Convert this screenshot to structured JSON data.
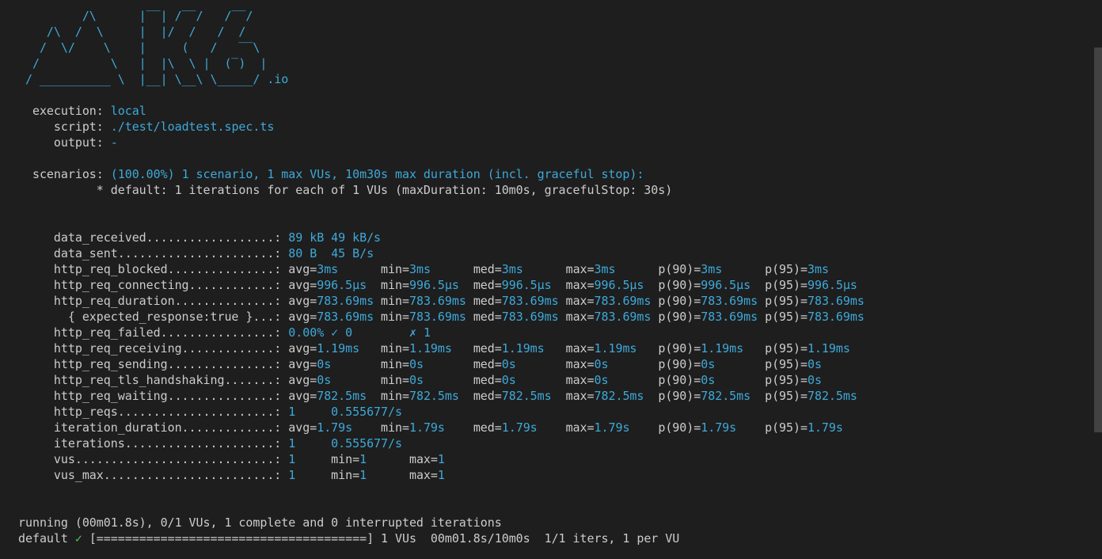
{
  "logo": {
    "lines": [
      "         /\\      |‾‾| /‾‾/   /‾‾/",
      "    /\\  /  \\     |  |/  /   /  /",
      "   /  \\/    \\    |     (   /   ‾‾\\",
      "  /          \\   |  |\\  \\ |  (‾)  |",
      " / __________ \\  |__| \\__\\ \\_____/"
    ],
    "suffix": " .io"
  },
  "execution": {
    "execution_label": "  execution: ",
    "execution_value": "local",
    "script_label": "     script: ",
    "script_value": "./test/loadtest.spec.ts",
    "output_label": "     output: ",
    "output_value": "-"
  },
  "scenarios": {
    "label": "  scenarios: ",
    "summary": "(100.00%) 1 scenario, 1 max VUs, 10m30s max duration (incl. graceful stop):",
    "detail": "           * default: 1 iterations for each of 1 VUs (maxDuration: 10m0s, gracefulStop: 30s)"
  },
  "metrics": [
    {
      "name": "     data_received..................: ",
      "cols": [
        [
          "",
          "89 kB"
        ],
        [
          " ",
          "49 kB/s"
        ]
      ]
    },
    {
      "name": "     data_sent......................: ",
      "cols": [
        [
          "",
          "80 B"
        ],
        [
          "  ",
          "45 B/s"
        ]
      ]
    },
    {
      "name": "     http_req_blocked...............: ",
      "cols": [
        [
          "avg=",
          "3ms"
        ],
        [
          "      min=",
          "3ms"
        ],
        [
          "      med=",
          "3ms"
        ],
        [
          "      max=",
          "3ms"
        ],
        [
          "      p(90)=",
          "3ms"
        ],
        [
          "      p(95)=",
          "3ms"
        ]
      ]
    },
    {
      "name": "     http_req_connecting............: ",
      "cols": [
        [
          "avg=",
          "996.5µs"
        ],
        [
          "  min=",
          "996.5µs"
        ],
        [
          "  med=",
          "996.5µs"
        ],
        [
          "  max=",
          "996.5µs"
        ],
        [
          "  p(90)=",
          "996.5µs"
        ],
        [
          "  p(95)=",
          "996.5µs"
        ]
      ]
    },
    {
      "name": "     http_req_duration..............: ",
      "cols": [
        [
          "avg=",
          "783.69ms"
        ],
        [
          " min=",
          "783.69ms"
        ],
        [
          " med=",
          "783.69ms"
        ],
        [
          " max=",
          "783.69ms"
        ],
        [
          " p(90)=",
          "783.69ms"
        ],
        [
          " p(95)=",
          "783.69ms"
        ]
      ]
    },
    {
      "name": "       { expected_response:true }...: ",
      "cols": [
        [
          "avg=",
          "783.69ms"
        ],
        [
          " min=",
          "783.69ms"
        ],
        [
          " med=",
          "783.69ms"
        ],
        [
          " max=",
          "783.69ms"
        ],
        [
          " p(90)=",
          "783.69ms"
        ],
        [
          " p(95)=",
          "783.69ms"
        ]
      ]
    },
    {
      "name": "     http_req_failed................: ",
      "cols": [
        [
          "",
          "0.00%"
        ],
        [
          " ",
          "✓ 0"
        ],
        [
          "        ",
          "✗ 1"
        ]
      ]
    },
    {
      "name": "     http_req_receiving.............: ",
      "cols": [
        [
          "avg=",
          "1.19ms"
        ],
        [
          "   min=",
          "1.19ms"
        ],
        [
          "   med=",
          "1.19ms"
        ],
        [
          "   max=",
          "1.19ms"
        ],
        [
          "   p(90)=",
          "1.19ms"
        ],
        [
          "   p(95)=",
          "1.19ms"
        ]
      ]
    },
    {
      "name": "     http_req_sending...............: ",
      "cols": [
        [
          "avg=",
          "0s"
        ],
        [
          "       min=",
          "0s"
        ],
        [
          "       med=",
          "0s"
        ],
        [
          "       max=",
          "0s"
        ],
        [
          "       p(90)=",
          "0s"
        ],
        [
          "       p(95)=",
          "0s"
        ]
      ]
    },
    {
      "name": "     http_req_tls_handshaking.......: ",
      "cols": [
        [
          "avg=",
          "0s"
        ],
        [
          "       min=",
          "0s"
        ],
        [
          "       med=",
          "0s"
        ],
        [
          "       max=",
          "0s"
        ],
        [
          "       p(90)=",
          "0s"
        ],
        [
          "       p(95)=",
          "0s"
        ]
      ]
    },
    {
      "name": "     http_req_waiting...............: ",
      "cols": [
        [
          "avg=",
          "782.5ms"
        ],
        [
          "  min=",
          "782.5ms"
        ],
        [
          "  med=",
          "782.5ms"
        ],
        [
          "  max=",
          "782.5ms"
        ],
        [
          "  p(90)=",
          "782.5ms"
        ],
        [
          "  p(95)=",
          "782.5ms"
        ]
      ]
    },
    {
      "name": "     http_reqs......................: ",
      "cols": [
        [
          "",
          "1"
        ],
        [
          "     ",
          "0.555677/s"
        ]
      ]
    },
    {
      "name": "     iteration_duration.............: ",
      "cols": [
        [
          "avg=",
          "1.79s"
        ],
        [
          "    min=",
          "1.79s"
        ],
        [
          "    med=",
          "1.79s"
        ],
        [
          "    max=",
          "1.79s"
        ],
        [
          "    p(90)=",
          "1.79s"
        ],
        [
          "    p(95)=",
          "1.79s"
        ]
      ]
    },
    {
      "name": "     iterations.....................: ",
      "cols": [
        [
          "",
          "1"
        ],
        [
          "     ",
          "0.555677/s"
        ]
      ]
    },
    {
      "name": "     vus............................: ",
      "cols": [
        [
          "",
          "1"
        ],
        [
          "     min=",
          "1"
        ],
        [
          "      max=",
          "1"
        ]
      ]
    },
    {
      "name": "     vus_max........................: ",
      "cols": [
        [
          "",
          "1"
        ],
        [
          "     min=",
          "1"
        ],
        [
          "      max=",
          "1"
        ]
      ]
    }
  ],
  "status": {
    "running": "running (00m01.8s), 0/1 VUs, 1 complete and 0 interrupted iterations",
    "scenario": "default ",
    "check": "✓",
    "progress": " [======================================] 1 VUs  00m01.8s/10m0s  1/1 iters, 1 per VU"
  },
  "colors": {
    "background": "#1e1e1e",
    "text": "#cccccc",
    "accent": "#3ea9d9",
    "ok": "#4ec94e"
  }
}
